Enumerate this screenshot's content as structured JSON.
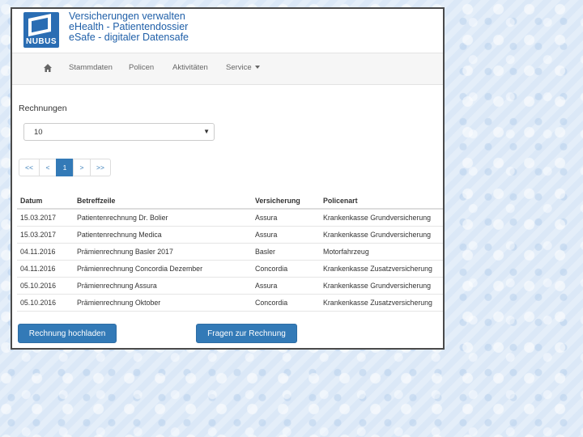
{
  "header": {
    "logo_text": "NUBUS",
    "titles": [
      "Versicherungen verwalten",
      "eHealth - Patientendossier",
      "eSafe - digitaler Datensafe"
    ]
  },
  "nav": {
    "home_icon": "home-icon",
    "items": [
      "Stammdaten",
      "Policen",
      "Aktivitäten",
      "Service"
    ]
  },
  "section": {
    "title": "Rechnungen"
  },
  "page_size_select": {
    "value": "10"
  },
  "pagination": {
    "first": "<<",
    "prev": "<",
    "current": "1",
    "next": ">",
    "last": ">>"
  },
  "table": {
    "headers": [
      "Datum",
      "Betreffzeile",
      "Versicherung",
      "Policenart"
    ],
    "rows": [
      [
        "15.03.2017",
        "Patientenrechnung Dr. Bolier",
        "Assura",
        "Krankenkasse Grundversicherung"
      ],
      [
        "15.03.2017",
        "Patientenrechnung Medica",
        "Assura",
        "Krankenkasse Grundversicherung"
      ],
      [
        "04.11.2016",
        "Prämienrechnung Basler 2017",
        "Basler",
        "Motorfahrzeug"
      ],
      [
        "04.11.2016",
        "Prämienrechnung Concordia Dezember",
        "Concordia",
        "Krankenkasse Zusatzversicherung"
      ],
      [
        "05.10.2016",
        "Prämienrechnung Assura",
        "Assura",
        "Krankenkasse Grundversicherung"
      ],
      [
        "05.10.2016",
        "Prämienrechnung Oktober",
        "Concordia",
        "Krankenkasse Zusatzversicherung"
      ]
    ]
  },
  "buttons": {
    "upload": "Rechnung hochladen",
    "questions": "Fragen zur Rechnung"
  },
  "colors": {
    "primary": "#337ab7",
    "title": "#1f5fa8",
    "logo": "#2a6db3"
  }
}
